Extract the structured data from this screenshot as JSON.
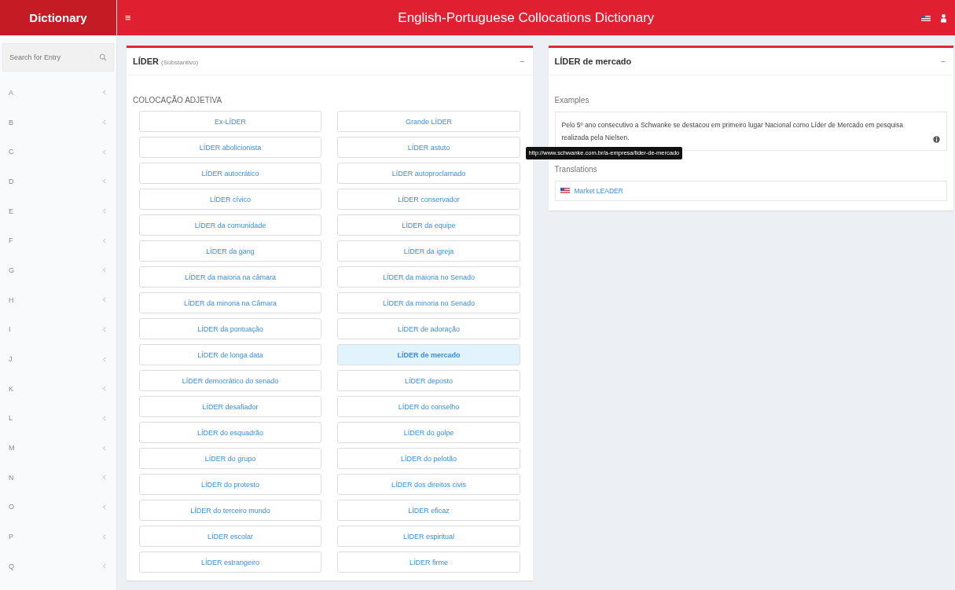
{
  "sidebar": {
    "brand": "Dictionary",
    "search": {
      "placeholder": "Search for Entry"
    },
    "letters": [
      "A",
      "B",
      "C",
      "D",
      "E",
      "F",
      "G",
      "H",
      "I",
      "J",
      "K",
      "L",
      "M",
      "N",
      "O",
      "P",
      "Q"
    ]
  },
  "header": {
    "menu_glyph": "≡",
    "title": "English-Portuguese Collocations Dictionary"
  },
  "entry_panel": {
    "word": "LÍDER",
    "pos": "(Substantivo)",
    "collapse_glyph": "−",
    "section": "COLOCAÇÃO ADJETIVA",
    "collocations": [
      {
        "label": "Ex-LÍDER",
        "selected": false
      },
      {
        "label": "Grande LÍDER",
        "selected": false
      },
      {
        "label": "LÍDER abolicionista",
        "selected": false
      },
      {
        "label": "LÍDER astuto",
        "selected": false
      },
      {
        "label": "LÍDER autocrático",
        "selected": false
      },
      {
        "label": "LÍDER autoproclamado",
        "selected": false
      },
      {
        "label": "LÍDER cívico",
        "selected": false
      },
      {
        "label": "LÍDER conservador",
        "selected": false
      },
      {
        "label": "LÍDER da comunidade",
        "selected": false
      },
      {
        "label": "LÍDER da equipe",
        "selected": false
      },
      {
        "label": "LÍDER da gang",
        "selected": false
      },
      {
        "label": "LÍDER da igreja",
        "selected": false
      },
      {
        "label": "LÍDER da maioria na câmara",
        "selected": false
      },
      {
        "label": "LÍDER da maioria no Senado",
        "selected": false
      },
      {
        "label": "LÍDER da minoria na Câmara",
        "selected": false
      },
      {
        "label": "LÍDER da minoria no Senado",
        "selected": false
      },
      {
        "label": "LÍDER da pontuação",
        "selected": false
      },
      {
        "label": "LÍDER de adoração",
        "selected": false
      },
      {
        "label": "LÍDER de longa data",
        "selected": false
      },
      {
        "label": "LÍDER de mercado",
        "selected": true
      },
      {
        "label": "LÍDER democrático do senado",
        "selected": false
      },
      {
        "label": "LÍDER deposto",
        "selected": false
      },
      {
        "label": "LÍDER desafiador",
        "selected": false
      },
      {
        "label": "LÍDER do conselho",
        "selected": false
      },
      {
        "label": "LÍDER do esquadrão",
        "selected": false
      },
      {
        "label": "LÍDER do golpe",
        "selected": false
      },
      {
        "label": "LÍDER do grupo",
        "selected": false
      },
      {
        "label": "LÍDER do pelotão",
        "selected": false
      },
      {
        "label": "LÍDER do protesto",
        "selected": false
      },
      {
        "label": "LÍDER dos direitos civis",
        "selected": false
      },
      {
        "label": "LÍDER do terceiro mundo",
        "selected": false
      },
      {
        "label": "LÍDER eficaz",
        "selected": false
      },
      {
        "label": "LÍDER escolar",
        "selected": false
      },
      {
        "label": "LÍDER espiritual",
        "selected": false
      },
      {
        "label": "LÍDER estrangeiro",
        "selected": false
      },
      {
        "label": "LÍDER firme",
        "selected": false
      }
    ]
  },
  "detail_panel": {
    "title": "LÍDER de mercado",
    "collapse_glyph": "−",
    "examples_heading": "Examples",
    "example": "Pelo 5º ano consecutivo a Schwanke se destacou em primeiro lugar Nacional como Líder de Mercado em pesquisa realizada pela Nielsen.",
    "tooltip": "http://www.schwanke.com.br/a-empresa/lider-de-mercado",
    "translations_heading": "Translations",
    "translations": [
      "Market LEADER"
    ]
  }
}
